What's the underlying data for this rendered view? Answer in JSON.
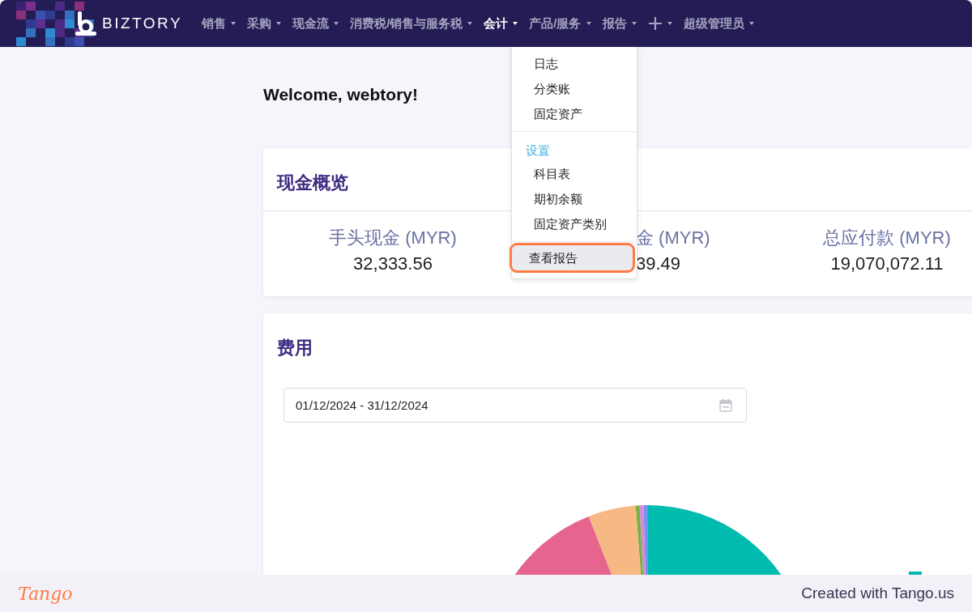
{
  "brand": {
    "name": "BIZTORY"
  },
  "nav": [
    {
      "kind": "text",
      "label": "销售",
      "selected": false
    },
    {
      "kind": "text",
      "label": "采购",
      "selected": false
    },
    {
      "kind": "text",
      "label": "现金流",
      "selected": false
    },
    {
      "kind": "text",
      "label": "消费税/销售与服务税",
      "selected": false
    },
    {
      "kind": "text",
      "label": "会计",
      "selected": true
    },
    {
      "kind": "text",
      "label": "产品/服务",
      "selected": false
    },
    {
      "kind": "text",
      "label": "报告",
      "selected": false
    },
    {
      "kind": "icon",
      "selected": false
    },
    {
      "kind": "text",
      "label": "超级管理员",
      "selected": false
    }
  ],
  "dropdown": {
    "groups": [
      {
        "items": [
          {
            "label": "日志",
            "selected": false
          },
          {
            "label": "分类账",
            "selected": false
          },
          {
            "label": "固定资产",
            "selected": false
          }
        ]
      },
      {
        "header": "设置",
        "items": [
          {
            "label": "科目表",
            "selected": false
          },
          {
            "label": "期初余额",
            "selected": false
          },
          {
            "label": "固定资产类别",
            "selected": false
          }
        ]
      },
      {
        "items": [
          {
            "label": "查看报告",
            "selected": true
          }
        ]
      }
    ]
  },
  "welcome": "Welcome, webtory!",
  "cash_overview": {
    "title": "现金概览",
    "stats": [
      {
        "label": "手头现金 (MYR)",
        "value": "32,333.56"
      },
      {
        "label": "金 (MYR)",
        "value": "39.49"
      },
      {
        "label": "总应付款 (MYR)",
        "value": "19,070,072.11"
      }
    ]
  },
  "expenses": {
    "title": "费用",
    "date_range": "01/12/2024 - 31/12/2024"
  },
  "footer": {
    "logo": "Tango",
    "credit": "Created with Tango.us"
  }
}
